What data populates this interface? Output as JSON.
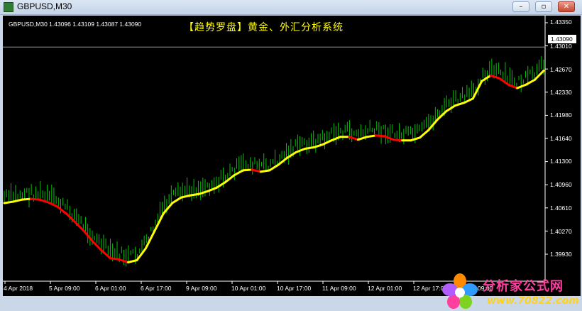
{
  "window": {
    "title": "GBPUSD,M30",
    "buttons": {
      "minimize": "–",
      "restore": "▫",
      "close": "✕"
    }
  },
  "chart": {
    "symbol_line": "GBPUSD,M30  1.43096 1.43109 1.43087 1.43090",
    "headline": "【趋势罗盘】黄金、外汇分析系统",
    "current_price": "1.43090",
    "price_labels": [
      "1.43350",
      "1.43010",
      "1.42670",
      "1.42330",
      "1.41980",
      "1.41640",
      "1.41300",
      "1.40960",
      "1.40610",
      "1.40270",
      "1.39930"
    ],
    "time_labels": [
      "4 Apr 2018",
      "5 Apr 09:00",
      "6 Apr 01:00",
      "6 Apr 17:00",
      "9 Apr 09:00",
      "10 Apr 01:00",
      "10 Apr 17:00",
      "11 Apr 09:00",
      "12 Apr 01:00",
      "12 Apr 17:00",
      "13 Apr 09:00"
    ],
    "colors": {
      "background": "#000000",
      "bars": "#00c000",
      "trend_up": "#ffff00",
      "trend_down": "#ff0000",
      "text": "#ffffff"
    }
  },
  "chart_data": {
    "type": "line",
    "ylim": [
      1.3975,
      1.4352
    ],
    "series": [
      {
        "values": [
          1.4085,
          1.4087,
          1.409,
          1.4091,
          1.409,
          1.4086,
          1.408,
          1.407,
          1.4058,
          1.4045,
          1.403,
          1.4017,
          1.4006,
          1.4004,
          1.4,
          1.4003,
          1.402,
          1.4045,
          1.407,
          1.4085,
          1.4093,
          1.4096,
          1.4098,
          1.4102,
          1.4107,
          1.4115,
          1.4125,
          1.4132,
          1.4133,
          1.413,
          1.4132,
          1.414,
          1.415,
          1.4158,
          1.4163,
          1.4165,
          1.4169,
          1.4175,
          1.418,
          1.418,
          1.4176,
          1.418,
          1.4182,
          1.4181,
          1.4176,
          1.4175,
          1.4175,
          1.4179,
          1.419,
          1.4205,
          1.4217,
          1.4225,
          1.4229,
          1.4235,
          1.426,
          1.4268,
          1.4264,
          1.4255,
          1.425,
          1.4255,
          1.4262,
          1.4275
        ]
      }
    ]
  }
}
